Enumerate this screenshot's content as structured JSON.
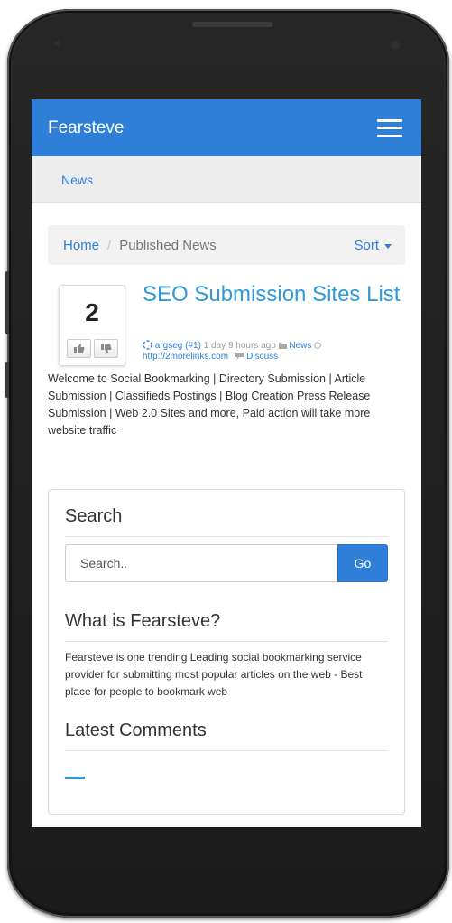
{
  "navbar": {
    "brand": "Fearsteve"
  },
  "subnav": {
    "link": "News"
  },
  "breadcrumb": {
    "home": "Home",
    "separator": "/",
    "current": "Published News",
    "sort": "Sort"
  },
  "story": {
    "votes": "2",
    "title": "SEO Submission Sites List",
    "author": "argseg (#1)",
    "time": "1 day 9 hours ago",
    "category": "News",
    "url": "http://2morelinks.com",
    "discuss": "Discuss",
    "description": "Welcome to Social Bookmarking | Directory Submission | Article Submission | Classifieds Postings | Blog Creation Press Release Submission | Web 2.0 Sites and more, Paid action will take more website traffic"
  },
  "sidebar": {
    "search_title": "Search",
    "search_placeholder": "Search..",
    "go_label": "Go",
    "about_title": "What is Fearsteve?",
    "about_text": "Fearsteve is one trending Leading social bookmarking service provider for submitting most popular articles on the web - Best place for people to bookmark web",
    "comments_title": "Latest Comments"
  },
  "colors": {
    "navbar": "#2f7fd8",
    "link": "#2f7fd8",
    "title": "#2f9ad8"
  }
}
